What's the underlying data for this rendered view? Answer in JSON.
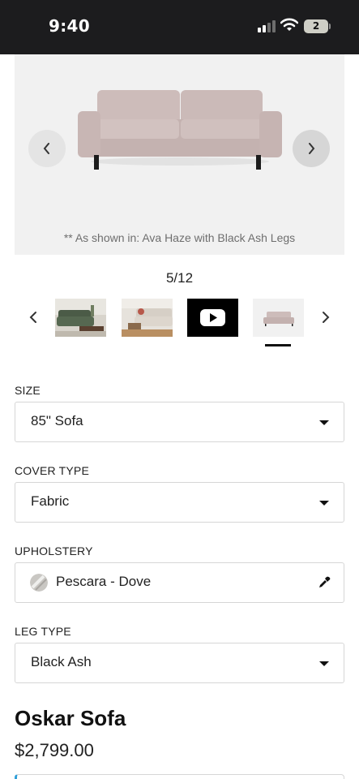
{
  "status_bar": {
    "time": "9:40",
    "battery_level": "2",
    "icons": [
      "signal-icon",
      "wifi-icon",
      "battery-icon"
    ]
  },
  "gallery": {
    "caption": "** As shown in: Ava Haze with Black Ash Legs",
    "counter": "5/12",
    "current_index": 5,
    "total": 12,
    "thumbnails": [
      {
        "name": "green-sofa-room-thumbnail"
      },
      {
        "name": "beige-sofa-room-thumbnail"
      },
      {
        "name": "video-thumbnail",
        "icon": "play-icon"
      },
      {
        "name": "pink-sofa-thumbnail",
        "selected": true
      }
    ]
  },
  "options": {
    "size": {
      "label": "SIZE",
      "value": "85\" Sofa"
    },
    "cover_type": {
      "label": "COVER TYPE",
      "value": "Fabric"
    },
    "upholstery": {
      "label": "UPHOLSTERY",
      "value": "Pescara - Dove",
      "icon": "eyedropper-icon"
    },
    "leg_type": {
      "label": "LEG TYPE",
      "value": "Black Ash"
    }
  },
  "product": {
    "title": "Oskar Sofa",
    "price": "$2,799.00"
  },
  "colors": {
    "status_bar_bg": "#1c1c1e",
    "sofa_fabric": "#c9b7b5",
    "accent_edge": "#2f9fd8"
  }
}
